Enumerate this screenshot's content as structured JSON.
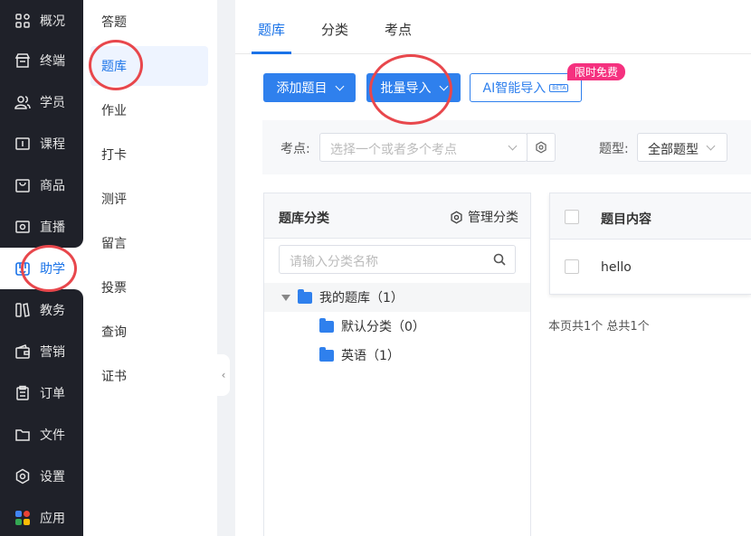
{
  "nav": {
    "items": [
      {
        "label": "概况",
        "icon": "dashboard-icon"
      },
      {
        "label": "终端",
        "icon": "store-icon"
      },
      {
        "label": "学员",
        "icon": "users-icon"
      },
      {
        "label": "课程",
        "icon": "course-icon"
      },
      {
        "label": "商品",
        "icon": "bag-icon"
      },
      {
        "label": "直播",
        "icon": "live-icon"
      },
      {
        "label": "助学",
        "icon": "study-icon"
      },
      {
        "label": "教务",
        "icon": "books-icon"
      },
      {
        "label": "营销",
        "icon": "wallet-icon"
      },
      {
        "label": "订单",
        "icon": "order-icon"
      },
      {
        "label": "文件",
        "icon": "folder-icon"
      },
      {
        "label": "设置",
        "icon": "settings-icon"
      },
      {
        "label": "应用",
        "icon": "apps-icon"
      }
    ],
    "active_index": 6
  },
  "subnav": {
    "items": [
      "答题",
      "题库",
      "作业",
      "打卡",
      "测评",
      "留言",
      "投票",
      "查询",
      "证书"
    ],
    "active_index": 1
  },
  "tabs": [
    "题库",
    "分类",
    "考点"
  ],
  "toolbar": {
    "add_label": "添加题目",
    "import_label": "批量导入",
    "ai_label": "AI智能导入",
    "ai_beta": "BETA",
    "promo_badge": "限时免费"
  },
  "filters": {
    "knowledge_label": "考点:",
    "knowledge_placeholder": "选择一个或者多个考点",
    "type_label": "题型:",
    "type_value": "全部题型"
  },
  "category": {
    "title": "题库分类",
    "manage_label": "管理分类",
    "search_placeholder": "请输入分类名称",
    "tree": [
      {
        "label": "我的题库（1）"
      },
      {
        "label": "默认分类（0）"
      },
      {
        "label": "英语（1）"
      }
    ]
  },
  "questions": {
    "header": "题目内容",
    "rows": [
      "hello"
    ],
    "footer": "本页共1个 总共1个"
  },
  "colors": {
    "accent": "#2f80ed",
    "nav_bg": "#1f2129",
    "badge": "#f5317f",
    "annotation": "#e8474c"
  }
}
